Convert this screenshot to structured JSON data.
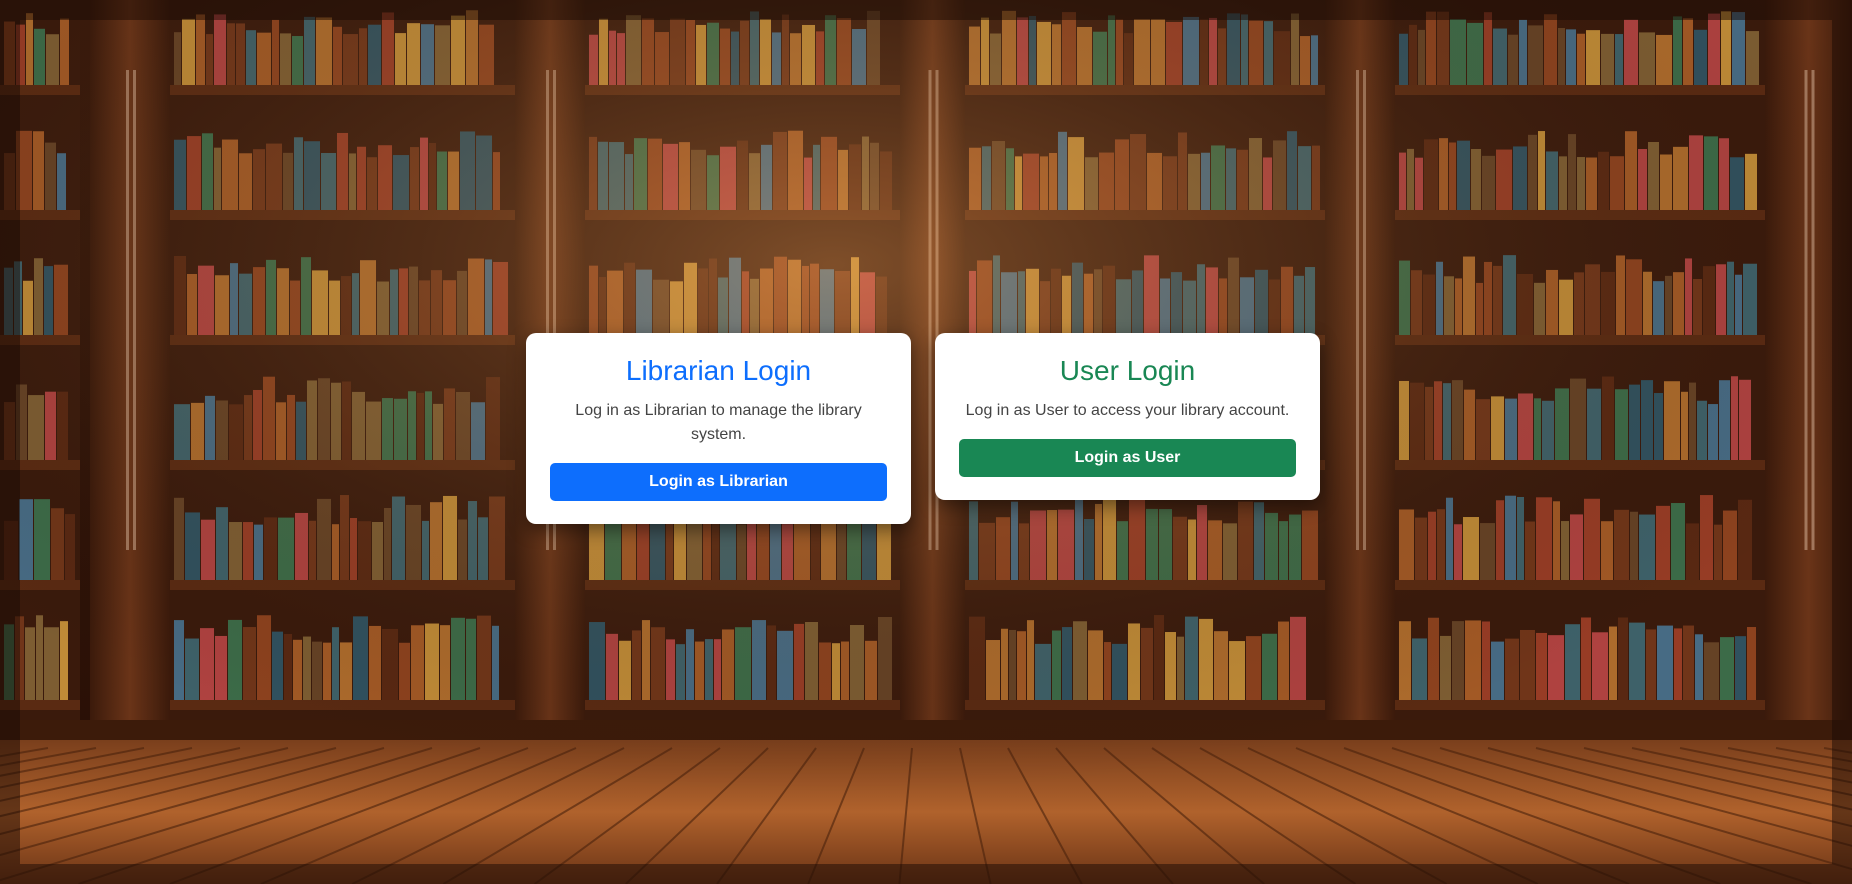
{
  "librarian_card": {
    "title": "Librarian Login",
    "description": "Log in as Librarian to manage the library system.",
    "button_label": "Login as Librarian",
    "accent": "#0d6efd"
  },
  "user_card": {
    "title": "User Login",
    "description": "Log in as User to access your library account.",
    "button_label": "Login as User",
    "accent": "#198754"
  },
  "background": {
    "subject": "wooden library bookshelves with wooden floor"
  }
}
